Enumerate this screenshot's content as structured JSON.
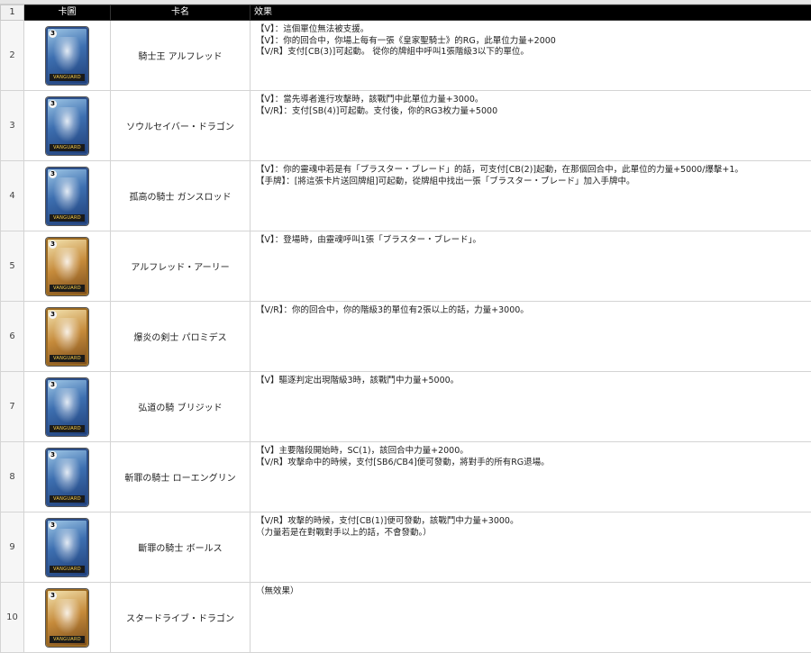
{
  "header": {
    "row_number": "1",
    "image_col": "卡圖",
    "name_col": "卡名",
    "effect_col": "效果"
  },
  "rows": [
    {
      "num": "2",
      "card_style": "blue",
      "grade": "3",
      "name": "騎士王 アルフレッド",
      "effect": [
        "【V】：這個單位無法被支援。",
        "【V】：你的回合中，你場上每有一張《皇家聖騎士》的RG，此單位力量+2000",
        "【V/R】支付[CB(3)]可起動。 從你的牌組中呼叫1張階級3以下的單位。"
      ]
    },
    {
      "num": "3",
      "card_style": "blue",
      "grade": "3",
      "name": "ソウルセイバー・ドラゴン",
      "effect": [
        "【V】：當先導者進行攻擊時，該戰鬥中此單位力量+3000。",
        "【V/R】：支付[SB(4)]可起動。支付後，你的RG3枚力量+5000"
      ]
    },
    {
      "num": "4",
      "card_style": "blue",
      "grade": "3",
      "name": "孤高の騎士 ガンスロッド",
      "effect": [
        "【V】：你的靈魂中若是有「ブラスター・ブレード」的話，可支付[CB(2)]起動，在那個回合中，此單位的力量+5000/爆擊+1。",
        "【手牌】：[將這張卡片送回牌組]可起動，從牌組中找出一張「ブラスター・ブレード」加入手牌中。"
      ]
    },
    {
      "num": "5",
      "card_style": "gold",
      "grade": "3",
      "name": "アルフレッド・アーリー",
      "effect": [
        "【V】：登場時，由靈魂呼叫1張「ブラスター・ブレード」。"
      ]
    },
    {
      "num": "6",
      "card_style": "gold",
      "grade": "3",
      "name": "爆炎の剣士 パロミデス",
      "effect": [
        "【V/R】：你的回合中，你的階級3的單位有2張以上的話，力量+3000。"
      ]
    },
    {
      "num": "7",
      "card_style": "blue",
      "grade": "3",
      "name": "弘道の騎 ブリジッド",
      "effect": [
        "【V】驅逐判定出現階級3時，該戰鬥中力量+5000。"
      ]
    },
    {
      "num": "8",
      "card_style": "blue",
      "grade": "3",
      "name": "斬罪の騎士 ローエングリン",
      "effect": [
        "【V】主要階段開始時，SC(1)，該回合中力量+2000。",
        "【V/R】攻擊命中的時候，支付[SB6/CB4]便可發動，將對手的所有RG退場。"
      ]
    },
    {
      "num": "9",
      "card_style": "blue",
      "grade": "3",
      "name": "斷罪の騎士 ボールス",
      "effect": [
        "【V/R】攻擊的時候，支付[CB(1)]便可發動，該戰鬥中力量+3000。",
        "（力量若是在對戰對手以上的話，不會發動。）"
      ]
    },
    {
      "num": "10",
      "card_style": "gold",
      "grade": "3",
      "name": "スタードライブ・ドラゴン",
      "effect": [
        "（無效果）"
      ]
    }
  ],
  "card_band_text": "VANGUARD"
}
